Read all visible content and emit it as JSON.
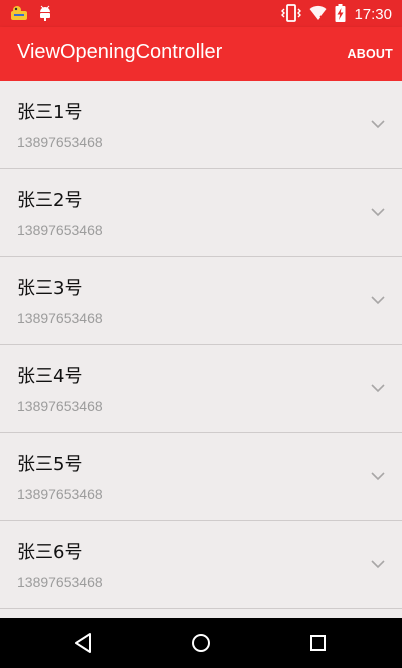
{
  "status_bar": {
    "time": "17:30",
    "icons": [
      "notification-app-icon",
      "android-debug-icon",
      "vibrate-icon",
      "wifi-icon",
      "battery-charging-icon"
    ]
  },
  "app_bar": {
    "title": "ViewOpeningController",
    "action_label": "ABOUT"
  },
  "contacts": [
    {
      "name": "张三1号",
      "phone": "13897653468"
    },
    {
      "name": "张三2号",
      "phone": "13897653468"
    },
    {
      "name": "张三3号",
      "phone": "13897653468"
    },
    {
      "name": "张三4号",
      "phone": "13897653468"
    },
    {
      "name": "张三5号",
      "phone": "13897653468"
    },
    {
      "name": "张三6号",
      "phone": "13897653468"
    }
  ],
  "nav_bar": {
    "icons": [
      "back-icon",
      "home-icon",
      "recents-icon"
    ]
  },
  "colors": {
    "status_bar": "#e8292a",
    "app_bar": "#f02d2d",
    "background": "#efecec",
    "divider": "#cfcbcb",
    "secondary_text": "#9c9c9c"
  }
}
